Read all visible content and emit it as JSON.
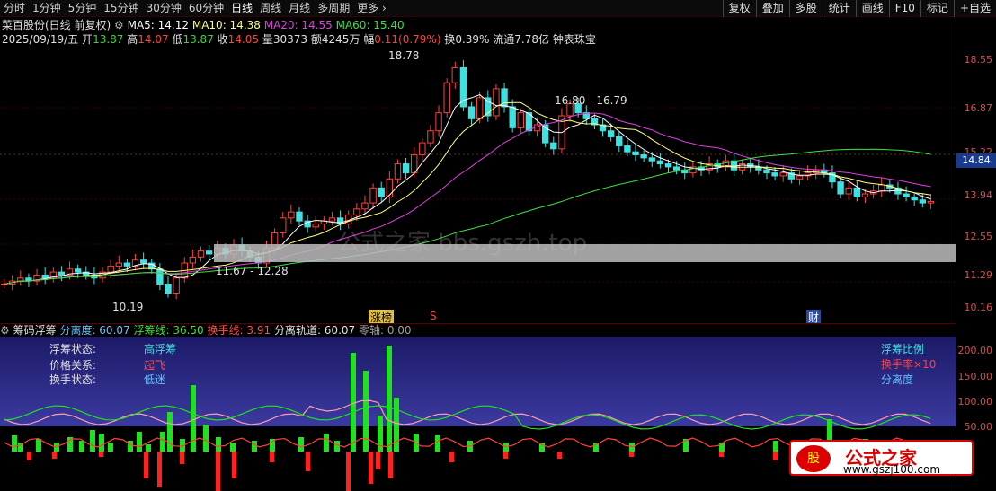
{
  "toolbar": {
    "tabs": [
      "分时",
      "1分钟",
      "5分钟",
      "15分钟",
      "30分钟",
      "60分钟",
      "日线",
      "周线",
      "月线",
      "多周期",
      "更多"
    ],
    "right": [
      "复权",
      "叠加",
      "多股",
      "统计",
      "画线",
      "F10",
      "标记",
      "+自选"
    ]
  },
  "header": {
    "title": "菜百股份(日线 前复权)",
    "ma5": "MA5: 14.12",
    "ma10": "MA10: 14.38",
    "ma20": "MA20: 14.55",
    "ma60": "MA60: 15.40",
    "date": "2025/09/19/五",
    "open_label": "开",
    "open": "13.87",
    "high_label": "高",
    "high": "14.07",
    "low_label": "低",
    "low": "13.87",
    "close_label": "收",
    "close": "14.05",
    "vol_label": "量",
    "vol": "30373",
    "amt_label": "额",
    "amt": "4245万",
    "chg_label": "幅",
    "chg": "0.11(0.79%)",
    "turn": "换0.39%",
    "float": "流通7.78亿",
    "industry": "钟表珠宝"
  },
  "price_axis": [
    "18.55",
    "16.87",
    "15.22",
    "13.94",
    "12.55",
    "11.29",
    "10.16"
  ],
  "current_price": "14.84",
  "annotations": {
    "high_mark": "18.78",
    "range1": "16.80 - 16.79",
    "range2": "11.67 - 12.28",
    "low_mark": "10.19",
    "tag_zt": "涨榜",
    "tag_s": "S",
    "tag_cai": "财"
  },
  "indicator": {
    "name": "筹码浮筹",
    "fenli": "分离度: 60.07",
    "fuchou": "浮筹线: 36.50",
    "huanshou": "换手线: 3.91",
    "guidao": "分离轨道: 60.07",
    "lingzhou": "零轴: 0.00"
  },
  "lower_axis": [
    "200.00",
    "150.00",
    "100.00",
    "50.00"
  ],
  "status": {
    "l1": "浮筹状态:",
    "v1": "高浮筹",
    "l2": "价格关系:",
    "v2": "起飞",
    "l3": "换手状态:",
    "v3": "低迷"
  },
  "legend": {
    "a": "浮筹比例",
    "b": "换手率×10",
    "c": "分离度"
  },
  "watermark": {
    "center": "公式之家 bbs.gszh.top",
    "logo_title": "公式之家",
    "logo_url": "www.gszj100.com",
    "logo_mark": "股"
  },
  "chart_data": {
    "type": "line",
    "closes": [
      11.3,
      11.4,
      11.5,
      11.4,
      11.6,
      11.5,
      11.7,
      11.6,
      11.8,
      11.7,
      11.6,
      11.5,
      11.7,
      11.9,
      12.0,
      11.9,
      12.1,
      12.0,
      11.8,
      11.3,
      11.0,
      11.5,
      12.0,
      12.2,
      12.4,
      12.3,
      12.5,
      12.3,
      12.6,
      12.4,
      12.2,
      12.0,
      12.5,
      13.0,
      13.5,
      13.7,
      13.4,
      13.2,
      13.3,
      13.4,
      13.5,
      13.3,
      13.6,
      13.8,
      14.0,
      14.5,
      14.2,
      14.8,
      15.3,
      15.0,
      15.6,
      16.0,
      16.4,
      17.0,
      18.0,
      18.5,
      17.2,
      16.8,
      17.5,
      16.9,
      17.8,
      17.2,
      16.5,
      17.0,
      16.4,
      16.6,
      16.0,
      15.8,
      16.9,
      17.3,
      17.0,
      16.8,
      16.6,
      16.4,
      16.2,
      15.9,
      15.7,
      15.6,
      15.5,
      15.4,
      15.3,
      15.2,
      15.1,
      15.0,
      15.2,
      15.1,
      15.3,
      15.2,
      15.4,
      15.1,
      15.3,
      15.2,
      15.1,
      15.0,
      14.9,
      15.0,
      14.8,
      14.9,
      15.0,
      15.1,
      15.0,
      14.7,
      14.3,
      14.5,
      14.2,
      14.3,
      14.4,
      14.6,
      14.5,
      14.3,
      14.2,
      14.1,
      14.0,
      14.05
    ],
    "ylim": [
      10.0,
      19.2
    ]
  }
}
